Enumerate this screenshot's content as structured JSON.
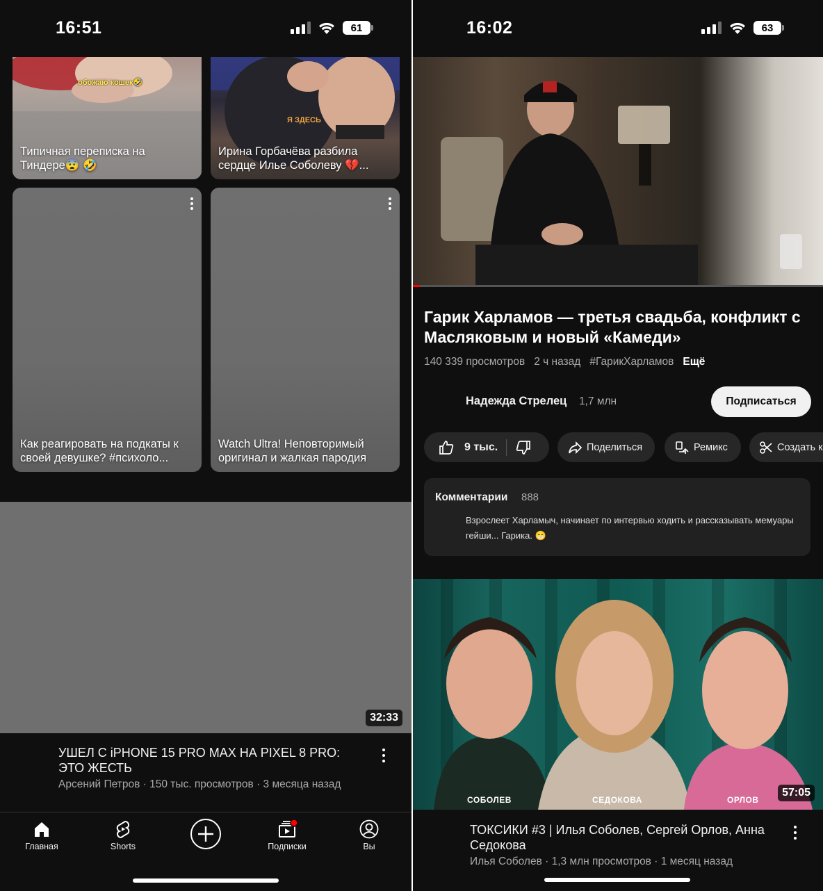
{
  "left": {
    "status": {
      "time": "16:51",
      "battery": "61"
    },
    "shorts": [
      {
        "title": "Типичная переписка на Тиндере😨 🤣",
        "overlay": "обожаю кошек🤣"
      },
      {
        "title": "Ирина Горбачёва разбила сердце Илье Соболеву 💔...",
        "overlay": "Я ЗДЕСЬ"
      },
      {
        "title": "Как реагировать на подкаты к своей девушке? #психоло..."
      },
      {
        "title": "Watch Ultra! Неповторимый оригинал и жалкая пародия"
      }
    ],
    "video": {
      "duration": "32:33",
      "title": "УШЕЛ С iPHONE 15 PRO MAX НА PIXEL 8 PRO: ЭТО ЖЕСТЬ",
      "meta": "Арсений Петров · 150 тыс. просмотров · 3 месяца назад"
    },
    "nav": {
      "home": "Главная",
      "shorts": "Shorts",
      "subscriptions": "Подписки",
      "you": "Вы"
    }
  },
  "right": {
    "status": {
      "time": "16:02",
      "battery": "63"
    },
    "video": {
      "title": "Гарик Харламов — третья свадьба, конфликт с Масляковым и новый «Камеди»",
      "views": "140 339 просмотров",
      "age": "2 ч назад",
      "hashtag": "#ГарикХарламов",
      "more": "Ещё"
    },
    "channel": {
      "name": "Надежда Стрелец",
      "subs": "1,7 млн",
      "subscribe": "Подписаться"
    },
    "actions": {
      "likes": "9 тыс.",
      "share": "Поделиться",
      "remix": "Ремикс",
      "create": "Создать к"
    },
    "comments": {
      "label": "Комментарии",
      "count": "888",
      "text": "Взрослеет Харламыч, начинает по интервью ходить и рассказывать мемуары гейши... Гарика. 😁"
    },
    "next_video": {
      "duration": "57:05",
      "names": [
        "СОБОЛЕВ",
        "СЕДОКОВА",
        "ОРЛОВ"
      ],
      "title": "ТОКСИКИ #3 | Илья Соболев, Сергей Орлов, Анна Седокова",
      "meta": "Илья Соболев · 1,3 млн просмотров · 1 месяц назад"
    }
  }
}
